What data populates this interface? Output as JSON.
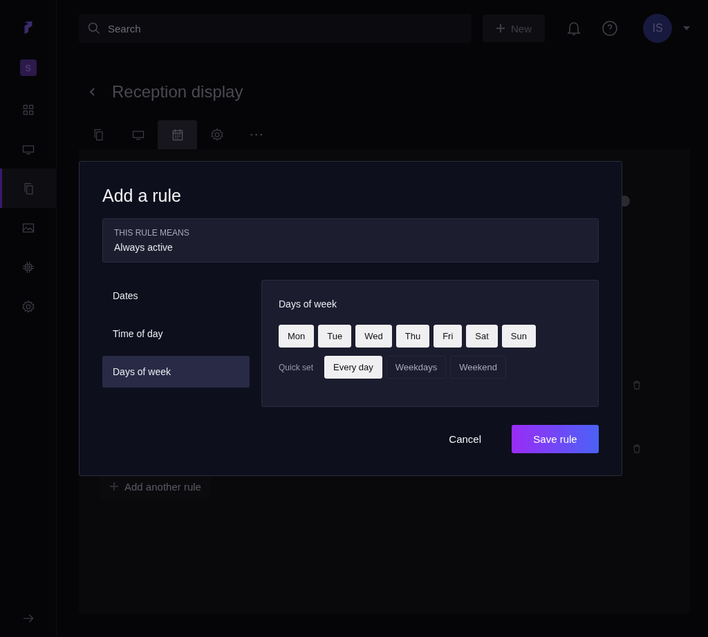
{
  "sidebar": {
    "workspace_badge": "S",
    "items": [
      {
        "kind": "grid",
        "selected": false
      },
      {
        "kind": "screen",
        "selected": false
      },
      {
        "kind": "pages",
        "selected": true
      },
      {
        "kind": "image",
        "selected": false
      },
      {
        "kind": "chip",
        "selected": false
      },
      {
        "kind": "gear",
        "selected": false
      }
    ]
  },
  "topbar": {
    "search": {
      "placeholder": "Search"
    },
    "new_button": "New",
    "avatar": "IS"
  },
  "page": {
    "title": "Reception display",
    "tabs": [
      {
        "kind": "pages",
        "selected": false
      },
      {
        "kind": "screen",
        "selected": false
      },
      {
        "kind": "calendar",
        "selected": true
      },
      {
        "kind": "gear",
        "selected": false
      },
      {
        "kind": "more",
        "selected": false
      }
    ],
    "add_rule_button": "Add another rule"
  },
  "modal": {
    "title": "Add a rule",
    "summary": {
      "label": "THIS RULE MEANS",
      "value": "Always active"
    },
    "categories": [
      {
        "label": "Dates",
        "selected": false
      },
      {
        "label": "Time of day",
        "selected": false
      },
      {
        "label": "Days of week",
        "selected": true
      }
    ],
    "panel": {
      "title": "Days of week",
      "days": [
        {
          "label": "Mon",
          "selected": true
        },
        {
          "label": "Tue",
          "selected": true
        },
        {
          "label": "Wed",
          "selected": true
        },
        {
          "label": "Thu",
          "selected": true
        },
        {
          "label": "Fri",
          "selected": true
        },
        {
          "label": "Sat",
          "selected": true
        },
        {
          "label": "Sun",
          "selected": true
        }
      ],
      "quick_set": {
        "label": "Quick set",
        "options": [
          {
            "label": "Every day",
            "selected": true
          },
          {
            "label": "Weekdays",
            "selected": false
          },
          {
            "label": "Weekend",
            "selected": false
          }
        ]
      }
    },
    "cancel_button": "Cancel",
    "save_button": "Save rule"
  }
}
